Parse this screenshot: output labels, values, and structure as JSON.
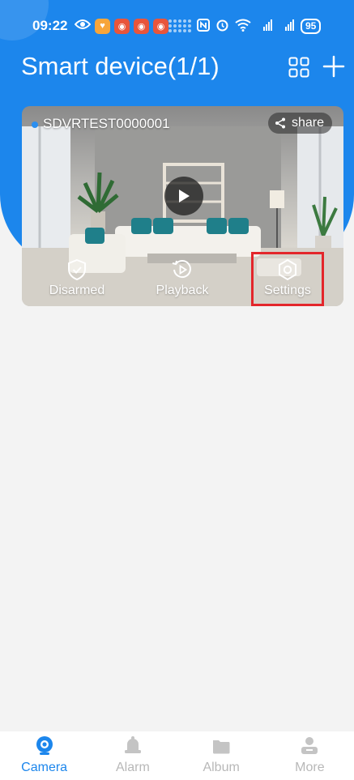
{
  "status_bar": {
    "time": "09:22",
    "battery": "95"
  },
  "header": {
    "title": "Smart device(1/1)"
  },
  "device_card": {
    "name": "SDVRTEST0000001",
    "share_label": "share",
    "actions": [
      "Disarmed",
      "Playback",
      "Settings"
    ]
  },
  "bottom_nav": {
    "items": [
      {
        "label": "Camera",
        "icon": "camera-icon",
        "active": true
      },
      {
        "label": "Alarm",
        "icon": "bell-icon",
        "active": false
      },
      {
        "label": "Album",
        "icon": "folder-icon",
        "active": false
      },
      {
        "label": "More",
        "icon": "user-icon",
        "active": false
      }
    ]
  },
  "colors": {
    "primary": "#1c86ec",
    "highlight": "#e3262b",
    "inactive": "#b8b8b8"
  }
}
